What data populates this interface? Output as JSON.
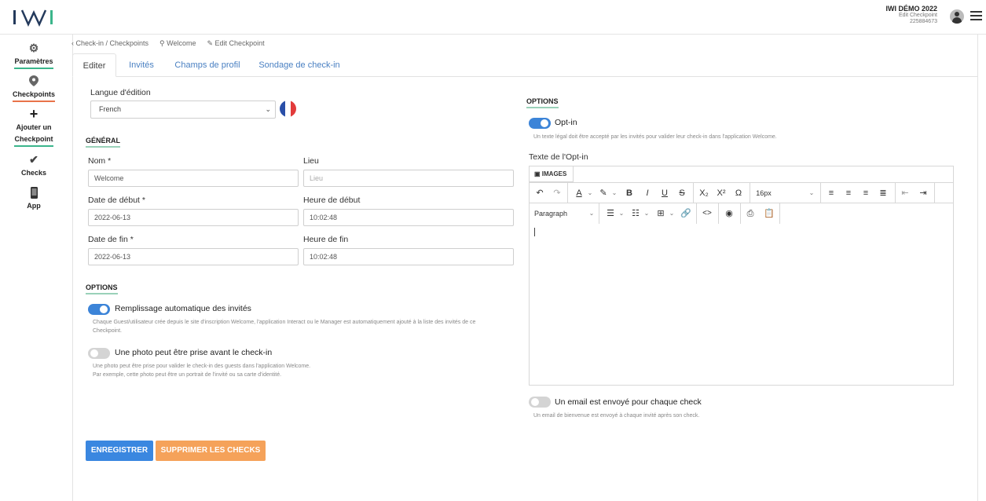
{
  "header": {
    "logo_text": "IWI",
    "account_name": "IWI DÉMO 2022",
    "account_sub": "Edit Checkpoint",
    "account_id": "225884673"
  },
  "sidebar": {
    "items": [
      {
        "label": "Paramètres",
        "icon": "gear-icon"
      },
      {
        "label": "Checkpoints",
        "icon": "map-pin-icon"
      },
      {
        "label": "Ajouter un",
        "label2": "Checkpoint",
        "icon": "plus-icon"
      },
      {
        "label": "Checks",
        "icon": "check-icon"
      },
      {
        "label": "App",
        "icon": "phone-icon"
      }
    ]
  },
  "breadcrumb": {
    "back": "Check-in / Checkpoints",
    "welcome": "Welcome",
    "edit": "Edit Checkpoint"
  },
  "tabs": [
    {
      "label": "Editer",
      "active": true
    },
    {
      "label": "Invités"
    },
    {
      "label": "Champs de profil"
    },
    {
      "label": "Sondage de check-in"
    }
  ],
  "form": {
    "langue_label": "Langue d'édition",
    "langue_value": "French",
    "general_title": "GÉNÉRAL",
    "nom_label": "Nom *",
    "nom_value": "Welcome",
    "lieu_label": "Lieu",
    "lieu_placeholder": "Lieu",
    "date_debut_label": "Date de début *",
    "date_debut_value": "2022-06-13",
    "heure_debut_label": "Heure de début",
    "heure_debut_value": "10:02:48",
    "date_fin_label": "Date de fin *",
    "date_fin_value": "2022-06-13",
    "heure_fin_label": "Heure de fin",
    "heure_fin_value": "10:02:48",
    "options_title": "OPTIONS",
    "auto_fill_label": "Remplissage automatique des invités",
    "auto_fill_on": true,
    "auto_fill_desc1": "Chaque Guest/utilisateur crée depuis le site d'inscription Welcome, l'application Interact ou le Manager est automatiquement ajouté à la liste des invités de ce",
    "auto_fill_desc2": "Checkpoint.",
    "photo_label": "Une photo peut être prise avant le check-in",
    "photo_on": false,
    "photo_desc1": "Une photo peut être prise pour valider le check-in des guests dans l'application Welcome.",
    "photo_desc2": "Par exemple, cette photo peut être un portrait de l'invité ou sa carte d'identité."
  },
  "right": {
    "options_title": "OPTIONS",
    "optin_label": "Opt-in",
    "optin_on": true,
    "optin_desc": "Un texte légal doit être accepté par les invités pour valider leur check-in dans l'application Welcome.",
    "optin_text_label": "Texte de l'Opt-in",
    "editor_tab": "IMAGES",
    "font_size": "16px",
    "paragraph": "Paragraph",
    "email_label": "Un email est envoyé pour chaque check",
    "email_on": false,
    "email_desc": "Un email de bienvenue est envoyé à chaque invité après son check."
  },
  "buttons": {
    "save": "ENREGISTRER",
    "delete_checks": "SUPPRIMER LES CHECKS"
  },
  "colors": {
    "accent_blue": "#3a87e0",
    "orange": "#f5a25a",
    "green_underline": "#3bb58b"
  }
}
